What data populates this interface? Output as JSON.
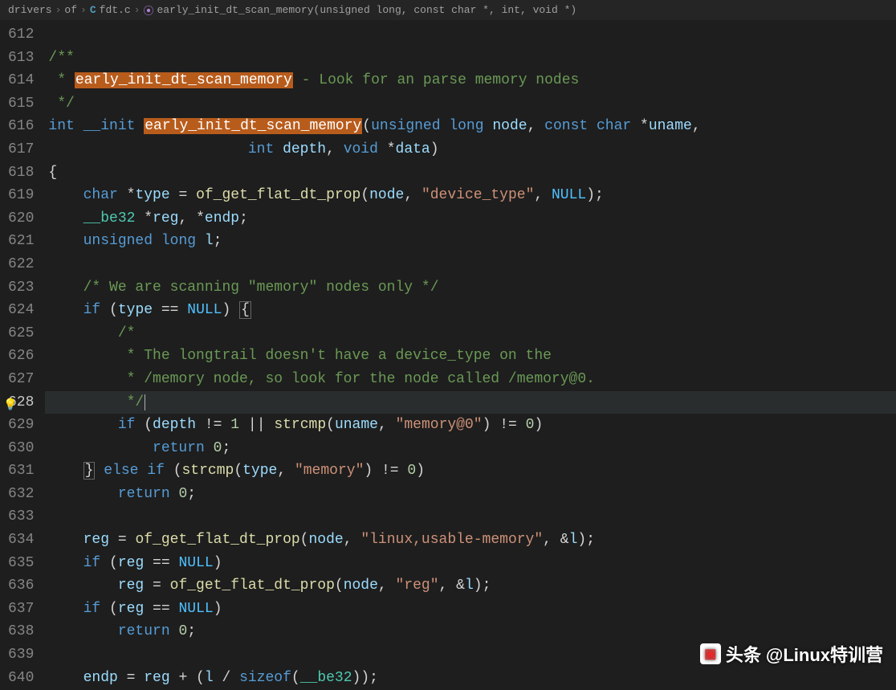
{
  "breadcrumb": {
    "folder1": "drivers",
    "folder2": "of",
    "file_icon": "C",
    "file": "fdt.c",
    "func_icon": "⦿",
    "func": "early_init_dt_scan_memory(unsigned long, const char *, int, void *)"
  },
  "watermark": {
    "label1": "头条",
    "label2": "@Linux特训营"
  },
  "line_start": 612,
  "line_end": 640,
  "active_line": 628,
  "code": {
    "l612": "",
    "l613": {
      "comment": "/**"
    },
    "l614": {
      "c1": " * ",
      "hl": "early_init_dt_scan_memory",
      "c2": " - Look for an parse memory nodes"
    },
    "l615": {
      "comment": " */"
    },
    "l616": {
      "kw1": "int",
      "kw2": "__init",
      "hl": "early_init_dt_scan_memory",
      "p1": "(",
      "t1": "unsigned long",
      "a1": " node",
      "c1": ", ",
      "t2": "const char ",
      "op": "*",
      "a2": "uname",
      "c2": ","
    },
    "l617": {
      "pad": "                       ",
      "t1": "int",
      "a1": " depth",
      "c1": ", ",
      "t2": "void ",
      "op": "*",
      "a2": "data",
      "p": ")"
    },
    "l618": {
      "brace": "{"
    },
    "l619": {
      "kw": "char ",
      "op1": "*",
      "v": "type",
      "eq": " = ",
      "fn": "of_get_flat_dt_prop",
      "p1": "(",
      "a1": "node",
      "c1": ", ",
      "s": "\"device_type\"",
      "c2": ", ",
      "n": "NULL",
      "p2": ");"
    },
    "l620": {
      "t": "__be32 ",
      "op1": "*",
      "v1": "reg",
      "c": ", ",
      "op2": "*",
      "v2": "endp",
      "s": ";"
    },
    "l621": {
      "t": "unsigned long",
      "v": " l",
      "s": ";"
    },
    "l622": "",
    "l623": {
      "comment": "/* We are scanning \"memory\" nodes only */"
    },
    "l624": {
      "kw": "if",
      "p1": " (",
      "v": "type",
      "eq": " == ",
      "n": "NULL",
      "p2": ") ",
      "br": "{"
    },
    "l625": {
      "comment": "/*"
    },
    "l626": {
      "comment": " * The longtrail doesn't have a device_type on the"
    },
    "l627": {
      "comment": " * /memory node, so look for the node called /memory@0."
    },
    "l628": {
      "comment": " */"
    },
    "l629": {
      "kw": "if",
      "p1": " (",
      "v1": "depth",
      "ne": " != ",
      "n1": "1",
      "or": " || ",
      "fn": "strcmp",
      "p2": "(",
      "v2": "uname",
      "c": ", ",
      "s": "\"memory@0\"",
      "p3": ")",
      "ne2": " != ",
      "n2": "0",
      "p4": ")"
    },
    "l630": {
      "kw": "return",
      "sp": " ",
      "n": "0",
      "s": ";"
    },
    "l631": {
      "br": "}",
      "sp": " ",
      "kw1": "else",
      "sp2": " ",
      "kw2": "if",
      "p1": " (",
      "fn": "strcmp",
      "p2": "(",
      "v": "type",
      "c": ", ",
      "s": "\"memory\"",
      "p3": ")",
      "ne": " != ",
      "n": "0",
      "p4": ")"
    },
    "l632": {
      "kw": "return",
      "sp": " ",
      "n": "0",
      "s": ";"
    },
    "l633": "",
    "l634": {
      "v": "reg",
      "eq": " = ",
      "fn": "of_get_flat_dt_prop",
      "p1": "(",
      "a1": "node",
      "c1": ", ",
      "s": "\"linux,usable-memory\"",
      "c2": ", ",
      "op": "&",
      "a2": "l",
      "p2": ");"
    },
    "l635": {
      "kw": "if",
      "p1": " (",
      "v": "reg",
      "eq": " == ",
      "n": "NULL",
      "p2": ")"
    },
    "l636": {
      "v": "reg",
      "eq": " = ",
      "fn": "of_get_flat_dt_prop",
      "p1": "(",
      "a1": "node",
      "c1": ", ",
      "s": "\"reg\"",
      "c2": ", ",
      "op": "&",
      "a2": "l",
      "p2": ");"
    },
    "l637": {
      "kw": "if",
      "p1": " (",
      "v": "reg",
      "eq": " == ",
      "n": "NULL",
      "p2": ")"
    },
    "l638": {
      "kw": "return",
      "sp": " ",
      "n": "0",
      "s": ";"
    },
    "l639": "",
    "l640": {
      "v1": "endp",
      "eq": " = ",
      "v2": "reg",
      "op1": " + (",
      "v3": "l",
      "op2": " / ",
      "fn": "sizeof",
      "p1": "(",
      "t": "__be32",
      "p2": "));"
    }
  }
}
